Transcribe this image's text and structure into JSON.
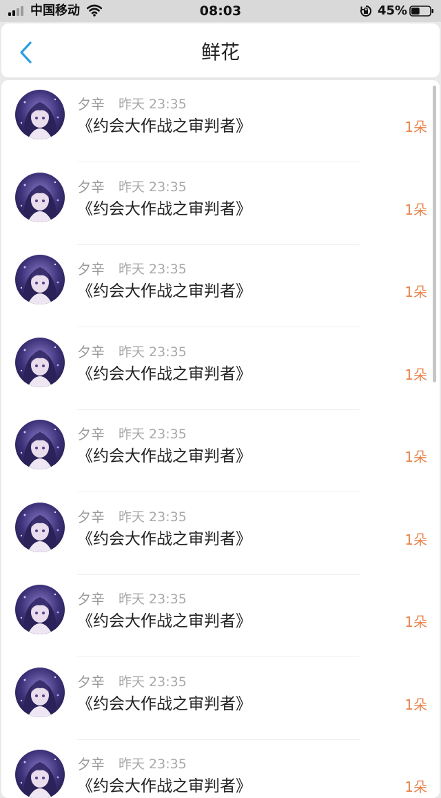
{
  "status_bar": {
    "carrier": "中国移动",
    "time": "08:03",
    "battery_percent": "45%",
    "battery_level": 0.45,
    "signal_bars_active": 2,
    "icons": [
      "signal-icon",
      "wifi-icon",
      "orientation-lock-icon",
      "battery-icon"
    ]
  },
  "nav": {
    "title": "鲜花",
    "back_icon": "chevron-left-icon",
    "accent_color": "#2a9ee0"
  },
  "colors": {
    "count_text": "#e8834a",
    "secondary_text": "#9a9a9a",
    "primary_text": "#222222"
  },
  "items": [
    {
      "name": "夕辛",
      "time": "昨天 23:35",
      "title": "《约会大作战之审判者》",
      "count": "1朵"
    },
    {
      "name": "夕辛",
      "time": "昨天 23:35",
      "title": "《约会大作战之审判者》",
      "count": "1朵"
    },
    {
      "name": "夕辛",
      "time": "昨天 23:35",
      "title": "《约会大作战之审判者》",
      "count": "1朵"
    },
    {
      "name": "夕辛",
      "time": "昨天 23:35",
      "title": "《约会大作战之审判者》",
      "count": "1朵"
    },
    {
      "name": "夕辛",
      "time": "昨天 23:35",
      "title": "《约会大作战之审判者》",
      "count": "1朵"
    },
    {
      "name": "夕辛",
      "time": "昨天 23:35",
      "title": "《约会大作战之审判者》",
      "count": "1朵"
    },
    {
      "name": "夕辛",
      "time": "昨天 23:35",
      "title": "《约会大作战之审判者》",
      "count": "1朵"
    },
    {
      "name": "夕辛",
      "time": "昨天 23:35",
      "title": "《约会大作战之审判者》",
      "count": "1朵"
    },
    {
      "name": "夕辛",
      "time": "昨天 23:35",
      "title": "《约会大作战之审判者》",
      "count": "1朵"
    }
  ]
}
